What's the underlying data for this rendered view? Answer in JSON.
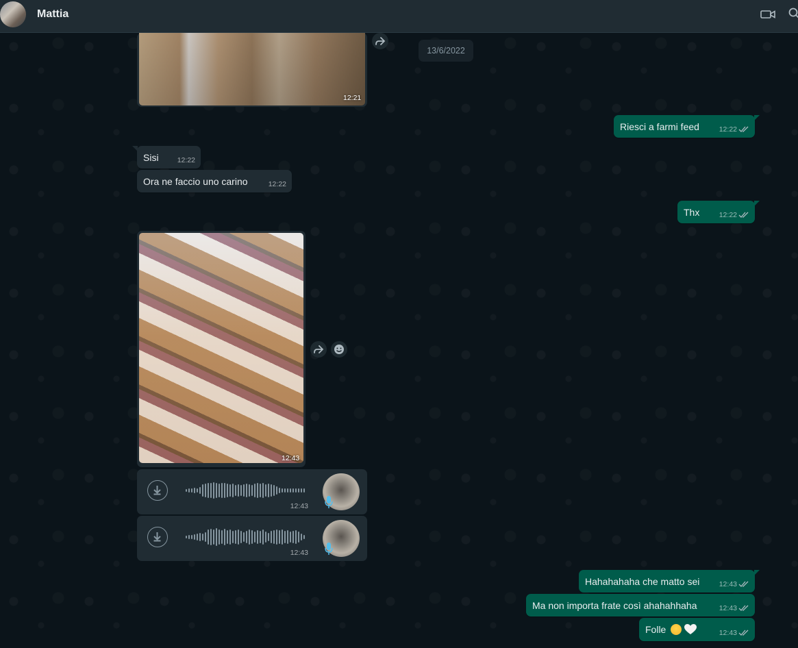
{
  "header": {
    "contact_name": "Mattia"
  },
  "date_chip": "13/6/2022",
  "messages": {
    "photo1": {
      "time": "12:21"
    },
    "m1": {
      "text": "Riesci a farmi feed",
      "time": "12:22"
    },
    "m2": {
      "text": "Sisi",
      "time": "12:22"
    },
    "m3": {
      "text": "Ora ne faccio uno carino",
      "time": "12:22"
    },
    "m4": {
      "text": "Thx",
      "time": "12:22"
    },
    "photo2": {
      "time": "12:43"
    },
    "voice1": {
      "time": "12:43"
    },
    "voice2": {
      "time": "12:43"
    },
    "m5": {
      "text": "Hahahahaha che matto sei",
      "time": "12:43"
    },
    "m6": {
      "text": "Ma non importa frate così ahahahhaha",
      "time": "12:43"
    },
    "m7": {
      "text": "Folle",
      "time": "12:43"
    }
  },
  "icons": {
    "header": [
      "video-call-icon",
      "search-icon"
    ],
    "message": [
      "forward-icon",
      "emoji-reaction-icon",
      "download-icon",
      "microphone-icon",
      "double-check-icon"
    ],
    "emoji": [
      "grinning-squinting-face-emoji",
      "white-heart-emoji"
    ]
  },
  "colors": {
    "background": "#0b141a",
    "header": "#202c33",
    "incoming_bubble": "#202c33",
    "outgoing_bubble": "#005c4b",
    "voice_mic_accent": "#53bdeb"
  }
}
